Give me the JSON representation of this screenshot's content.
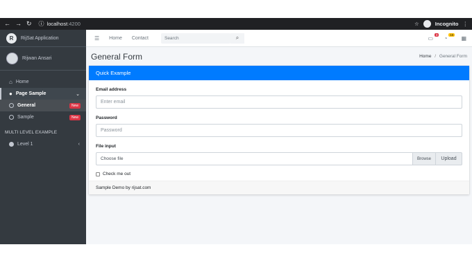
{
  "browser": {
    "url_host": "localhost",
    "url_port": ":4200",
    "profile": "Incognito"
  },
  "sidebar": {
    "brand": "RijSat Application",
    "brand_logo": "R",
    "user_name": "Rijwan Ansari",
    "items": [
      {
        "label": "Home",
        "icon": "home-icon"
      },
      {
        "label": "Page Sample",
        "icon": "user-icon"
      },
      {
        "label": "General",
        "badge": "New"
      },
      {
        "label": "Sample",
        "badge": "New"
      }
    ],
    "section_header": "MULTI LEVEL EXAMPLE",
    "level_item": "Level 1"
  },
  "topbar": {
    "home": "Home",
    "contact": "Contact",
    "search_placeholder": "Search",
    "messages_count": "3",
    "notifications_count": "15"
  },
  "page": {
    "title": "General Form",
    "breadcrumb_home": "Home",
    "breadcrumb_separator": "/",
    "breadcrumb_current": "General Form"
  },
  "form": {
    "card_title": "Quick Example",
    "email_label": "Email address",
    "email_placeholder": "Enter email",
    "password_label": "Password",
    "password_placeholder": "Password",
    "file_label": "File input",
    "file_placeholder": "Choose file",
    "browse_label": "Browse",
    "upload_label": "Upload",
    "check_label": "Check me out",
    "footer": "Sample Demo by rijsat.com"
  },
  "colors": {
    "primary": "#007bff",
    "sidebar": "#343a40",
    "badge": "#dc3545"
  }
}
